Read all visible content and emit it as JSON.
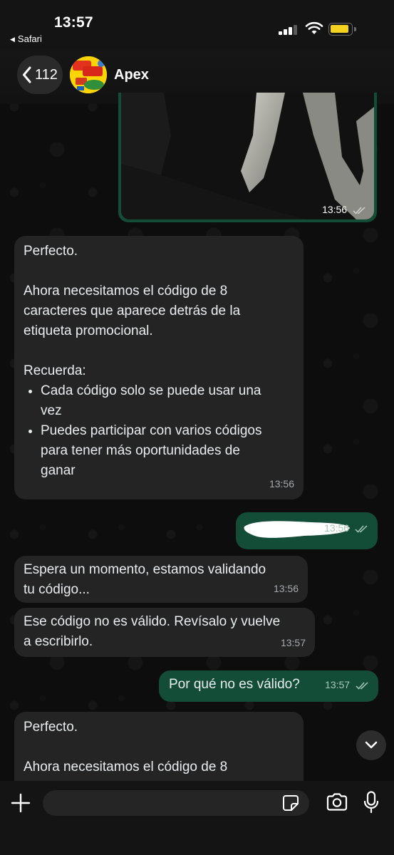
{
  "status_bar": {
    "time": "13:57",
    "back_app": "Safari"
  },
  "header": {
    "back_count": "112",
    "contact_name": "Apex"
  },
  "messages": [
    {
      "id": "image-msg",
      "direction": "outgoing",
      "type": "image",
      "time": "13:56",
      "read_ticks": "double"
    },
    {
      "id": "msg-perfecto-1",
      "direction": "incoming",
      "line1": "Perfecto.",
      "para2_line1": "Ahora necesitamos el código de 8",
      "para2_line2": "caracteres que aparece detrás de la",
      "para2_line3": "etiqueta promocional.",
      "line4": "Recuerda:",
      "bullet1_line1": "Cada código solo se puede usar una",
      "bullet1_line2": "vez",
      "bullet2_line1": "Puedes participar con varios códigos",
      "bullet2_line2": "para tener más oportunidades de",
      "bullet2_line3": "ganar",
      "time": "13:56"
    },
    {
      "id": "msg-redacted",
      "direction": "outgoing",
      "text": "",
      "time": "13:56",
      "read_ticks": "double"
    },
    {
      "id": "msg-espera",
      "direction": "incoming",
      "line1": "Espera un momento, estamos validando",
      "line2": "tu código...",
      "time": "13:56"
    },
    {
      "id": "msg-invalido",
      "direction": "incoming",
      "line1": "Ese código no es válido. Revísalo y vuelve",
      "line2": "a escribirlo.",
      "time": "13:57"
    },
    {
      "id": "msg-porque",
      "direction": "outgoing",
      "text": "Por qué no es válido?",
      "time": "13:57",
      "read_ticks": "double"
    },
    {
      "id": "msg-perfecto-2",
      "direction": "incoming",
      "line1": "Perfecto.",
      "line2": "Ahora necesitamos el código de 8"
    }
  ],
  "input": {
    "value": "",
    "placeholder": ""
  },
  "icons": {
    "back": "chevron-left-icon",
    "plus": "plus-icon",
    "sticker": "sticker-icon",
    "camera": "camera-icon",
    "mic": "microphone-icon",
    "scroll": "chevron-down-icon"
  },
  "colors": {
    "incoming_bubble": "#242424",
    "outgoing_bubble": "#134d37",
    "battery": "#f5d21f",
    "read_ticks": "#a9c8ba"
  }
}
